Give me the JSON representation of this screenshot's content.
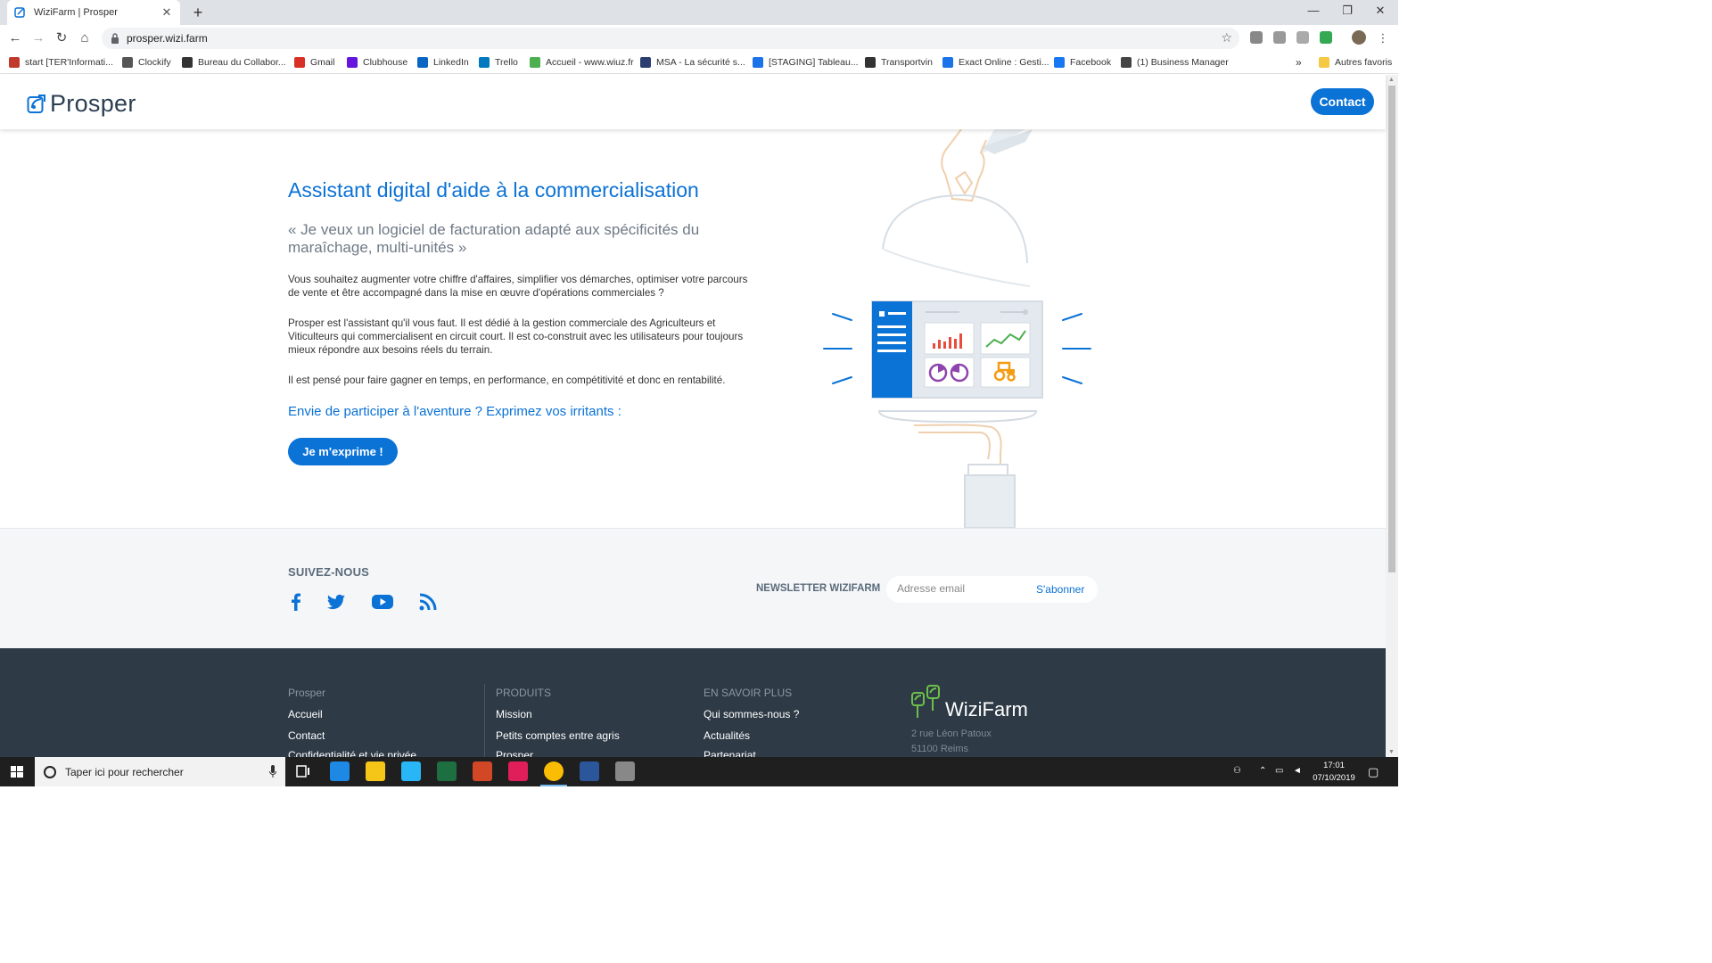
{
  "browser": {
    "tab_title": "WiziFarm | Prosper",
    "tab_close": "✕",
    "new_tab": "+",
    "url": "prosper.wizi.farm",
    "controls": {
      "minimize": "—",
      "maximize": "❐",
      "close": "✕"
    },
    "bookmarks": [
      {
        "label": "start [TER'Informati...",
        "color": "#c0392b"
      },
      {
        "label": "Clockify",
        "color": "#555555"
      },
      {
        "label": "Bureau du Collabor...",
        "color": "#333333"
      },
      {
        "label": "Gmail",
        "color": "#d93025"
      },
      {
        "label": "Clubhouse",
        "color": "#6515dd"
      },
      {
        "label": "LinkedIn",
        "color": "#0a66c2"
      },
      {
        "label": "Trello",
        "color": "#0079bf"
      },
      {
        "label": "Accueil - www.wiuz.fr",
        "color": "#4caf50"
      },
      {
        "label": "MSA - La sécurité s...",
        "color": "#2c3e70"
      },
      {
        "label": "[STAGING] Tableau...",
        "color": "#1a73e8"
      },
      {
        "label": "Transportvin",
        "color": "#333333"
      },
      {
        "label": "Exact Online : Gesti...",
        "color": "#1a73e8"
      },
      {
        "label": "Facebook",
        "color": "#1877f2"
      },
      {
        "label": "(1) Business Manager",
        "color": "#444444"
      }
    ],
    "bookmarks_more": "»",
    "other_bookmarks": "Autres favoris"
  },
  "header": {
    "logo_text": "Prosper",
    "contact_label": "Contact"
  },
  "hero": {
    "title": "Assistant digital d'aide à la commercialisation",
    "quote": "« Je veux un logiciel de facturation adapté aux spécificités du maraîchage, multi-unités »",
    "paragraphs": [
      "Vous souhaitez augmenter votre chiffre d'affaires, simplifier vos démarches, optimiser votre parcours de vente et être accompagné dans la mise en œuvre d'opérations commerciales ?",
      "Prosper est l'assistant qu'il vous faut. Il est dédié à la gestion commerciale des Agriculteurs et Viticulteurs qui commercialisent en circuit court. Il est co-construit avec les utilisateurs pour toujours mieux répondre aux besoins réels du terrain.",
      "Il est pensé pour faire gagner en temps, en performance, en compétitivité et donc en rentabilité."
    ],
    "cta_text": "Envie de participer à l'aventure ? Exprimez vos irritants :",
    "cta_button": "Je m'exprime !"
  },
  "follow": {
    "title": "SUIVEZ-NOUS",
    "social_icons": [
      "facebook-icon",
      "twitter-icon",
      "youtube-icon",
      "rss-icon"
    ],
    "newsletter_label": "NEWSLETTER WIZIFARM",
    "email_placeholder": "Adresse email",
    "subscribe_label": "S'abonner"
  },
  "footer": {
    "col1": {
      "title": "Prosper",
      "links": [
        "Accueil",
        "Contact",
        "Confidentialité et vie privée"
      ]
    },
    "col2": {
      "title": "PRODUITS",
      "links": [
        "Mission",
        "Petits comptes entre agris",
        "Prosper"
      ]
    },
    "col3": {
      "title": "EN SAVOIR PLUS",
      "links": [
        "Qui sommes-nous ?",
        "Actualités",
        "Partenariat"
      ]
    },
    "brand": "WiziFarm",
    "address_line1": "2 rue Léon Patoux",
    "address_line2": "51100 Reims"
  },
  "taskbar": {
    "search_placeholder": "Taper ici pour rechercher",
    "time": "17:01",
    "date": "07/10/2019"
  },
  "colors": {
    "brand_blue": "#0b72d6",
    "footer_bg": "#2e3a46",
    "follow_bg": "#f4f6f8"
  }
}
